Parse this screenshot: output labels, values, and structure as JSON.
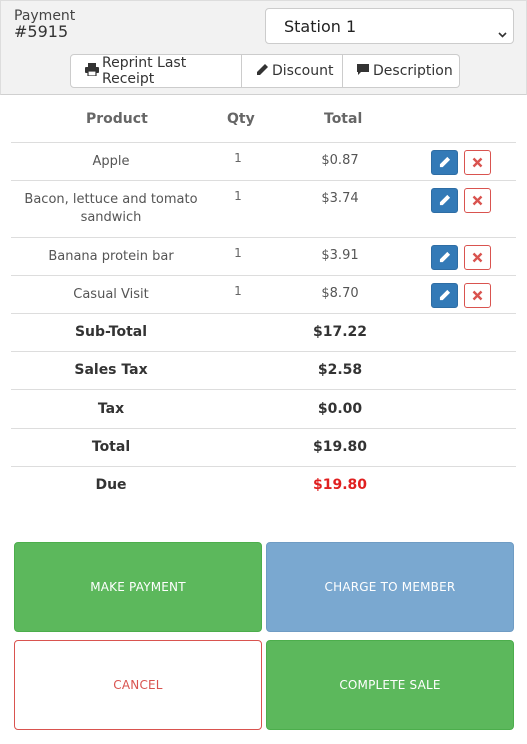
{
  "header": {
    "payment_label": "Payment",
    "payment_number": "#5915",
    "station_selected": "Station 1"
  },
  "actions": {
    "reprint_label": "Reprint Last Receipt",
    "discount_label": "Discount",
    "description_label": "Description"
  },
  "table": {
    "col_product": "Product",
    "col_qty": "Qty",
    "col_total": "Total",
    "items": [
      {
        "product_line1": "Apple",
        "product_line2": "",
        "qty": "1",
        "total": "$0.87"
      },
      {
        "product_line1": "Bacon, lettuce and tomato",
        "product_line2": "sandwich",
        "qty": "1",
        "total": "$3.74"
      },
      {
        "product_line1": "Banana protein bar",
        "product_line2": "",
        "qty": "1",
        "total": "$3.91"
      },
      {
        "product_line1": "Casual Visit",
        "product_line2": "",
        "qty": "1",
        "total": "$8.70"
      }
    ]
  },
  "summary": {
    "subtotal_label": "Sub-Total",
    "subtotal_value": "$17.22",
    "sales_tax_label": "Sales Tax",
    "sales_tax_value": "$2.58",
    "tax_label": "Tax",
    "tax_value": "$0.00",
    "total_label": "Total",
    "total_value": "$19.80",
    "due_label": "Due",
    "due_value": "$19.80"
  },
  "buttons": {
    "make_payment": "MAKE PAYMENT",
    "charge_to_member": "CHARGE TO MEMBER",
    "cancel": "CANCEL",
    "complete_sale": "COMPLETE SALE"
  },
  "colors": {
    "due_amount": "#e02020",
    "success_green": "#5cb85c",
    "charge_blue": "#7aa8d0",
    "danger_red": "#d9534f",
    "edit_blue": "#337ab7"
  },
  "icons": {
    "reprint": "printer-icon",
    "discount": "pencil-icon",
    "description": "comment-icon",
    "station": "chevron-down-icon",
    "edit": "pencil-icon",
    "delete": "x-icon"
  }
}
